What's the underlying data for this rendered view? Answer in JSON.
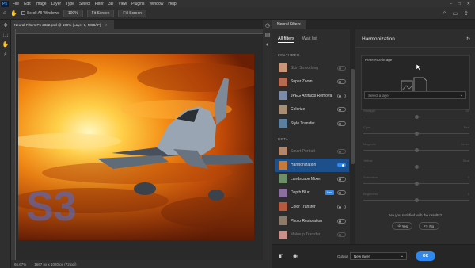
{
  "menubar": {
    "logo": "Ps",
    "items": [
      "File",
      "Edit",
      "Image",
      "Layer",
      "Type",
      "Select",
      "Filter",
      "3D",
      "View",
      "Plugins",
      "Window",
      "Help"
    ]
  },
  "options_bar": {
    "scroll_all_windows": "Scroll All Windows",
    "zoom_value": "100%",
    "fit_screen": "Fit Screen",
    "fill_screen": "Fill Screen"
  },
  "document": {
    "tab_title": "Neural-Filters-Ps-2022.psd @ 100% (Layer 1, RGB/8*)",
    "status_zoom": "66.67%",
    "status_size": "1667 px x 1080 px (72 ppi)"
  },
  "neural_filters": {
    "panel_tab": "Neural Filters",
    "tabs": {
      "all_filters": "All filters",
      "wait_list": "Wait list"
    },
    "featured_label": "FEATURED",
    "beta_label": "BETA",
    "featured": [
      {
        "name": "Skin Smoothing",
        "enabled": false,
        "dimmed": true,
        "thumb_color": "#c9967a"
      },
      {
        "name": "Super Zoom",
        "enabled": false,
        "dimmed": false,
        "thumb_color": "#b56a52"
      },
      {
        "name": "JPEG Artifacts Removal",
        "enabled": false,
        "dimmed": false,
        "thumb_color": "#7a8ca8"
      },
      {
        "name": "Colorize",
        "enabled": false,
        "dimmed": false,
        "thumb_color": "#a88f74"
      },
      {
        "name": "Style Transfer",
        "enabled": false,
        "dimmed": false,
        "thumb_color": "#5d7f9e"
      }
    ],
    "beta": [
      {
        "name": "Smart Portrait",
        "enabled": false,
        "dimmed": true,
        "thumb_color": "#b4876c",
        "selected": false
      },
      {
        "name": "Harmonization",
        "enabled": true,
        "dimmed": false,
        "thumb_color": "#c77a3a",
        "selected": true
      },
      {
        "name": "Landscape Mixer",
        "enabled": false,
        "dimmed": false,
        "thumb_color": "#6f8f6a",
        "selected": false
      },
      {
        "name": "Depth Blur",
        "enabled": false,
        "dimmed": false,
        "thumb_color": "#8a6f9e",
        "selected": false,
        "badge": "New"
      },
      {
        "name": "Color Transfer",
        "enabled": false,
        "dimmed": false,
        "thumb_color": "#b55a3e",
        "selected": false
      },
      {
        "name": "Photo Restoration",
        "enabled": false,
        "dimmed": false,
        "thumb_color": "#8c7b6b",
        "selected": false
      },
      {
        "name": "Makeup Transfer",
        "enabled": false,
        "dimmed": true,
        "thumb_color": "#c98f8a",
        "selected": false
      }
    ],
    "settings": {
      "title": "Harmonization",
      "reference_image_label": "Reference image",
      "select_layer_placeholder": "Select a layer",
      "sliders": [
        {
          "label": "Strength",
          "value": "50",
          "level": 0.5
        },
        {
          "label": "Cyan",
          "value": "Red",
          "level": 0.5
        },
        {
          "label": "Magenta",
          "value": "Green",
          "level": 0.5
        },
        {
          "label": "Yellow",
          "value": "Blue",
          "level": 0.5
        },
        {
          "label": "Saturation",
          "value": "0",
          "level": 0.5
        },
        {
          "label": "Brightness",
          "value": "0",
          "level": 0.5
        }
      ],
      "satisfied_question": "Are you satisfied with the results?",
      "yes_label": "Yes",
      "no_label": "No"
    },
    "footer": {
      "output_label": "Output",
      "output_value": "New layer",
      "ok_label": "OK"
    }
  },
  "watermark": "S3",
  "colors": {
    "accent": "#2e88f0",
    "selected_row": "#1d4f8a",
    "panel_bg": "#2d2d2d"
  }
}
